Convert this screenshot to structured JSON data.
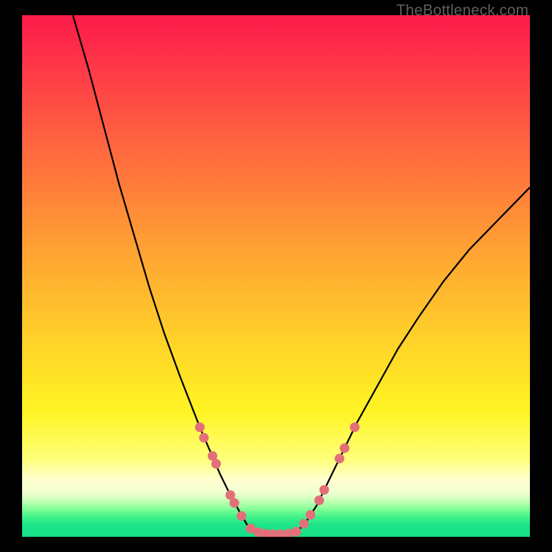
{
  "watermark": "TheBottleneck.com",
  "colors": {
    "frame": "#000000",
    "gradient_stops": [
      "#fd1a4a",
      "#fe3e47",
      "#ff6f3e",
      "#ffa233",
      "#ffd129",
      "#fff423",
      "#ffff7a",
      "#ffffcf",
      "#f0ffd1",
      "#c8ffb6",
      "#8bff9a",
      "#47f58b",
      "#20e588",
      "#15df87"
    ],
    "curve": "#000000",
    "dots": "#e37079"
  },
  "chart_data": {
    "type": "line",
    "title": "",
    "xlabel": "",
    "ylabel": "",
    "xlim": [
      0,
      100
    ],
    "ylim": [
      0,
      100
    ],
    "series": [
      {
        "name": "left-branch",
        "x": [
          10,
          13,
          16,
          19,
          22,
          25,
          28,
          31,
          33,
          35,
          37,
          39,
          41,
          43,
          44.5,
          46
        ],
        "y": [
          100,
          90,
          79,
          68,
          58,
          48,
          39,
          31,
          26,
          21,
          16.5,
          12,
          8,
          4.5,
          2,
          0.8
        ]
      },
      {
        "name": "valley-floor",
        "x": [
          46,
          48,
          50,
          52,
          54
        ],
        "y": [
          0.8,
          0.5,
          0.5,
          0.5,
          0.8
        ]
      },
      {
        "name": "right-branch",
        "x": [
          54,
          56,
          58,
          60,
          63,
          66,
          70,
          74,
          78,
          83,
          88,
          94,
          100
        ],
        "y": [
          0.8,
          3,
          6,
          10,
          16,
          22,
          29,
          36,
          42,
          49,
          55,
          61,
          67
        ]
      }
    ],
    "points": [
      {
        "name": "left-cluster-top-1",
        "x": 35.0,
        "y": 21.0
      },
      {
        "name": "left-cluster-top-2",
        "x": 35.8,
        "y": 19.0
      },
      {
        "name": "left-cluster-mid-1",
        "x": 37.5,
        "y": 15.5
      },
      {
        "name": "left-cluster-mid-2",
        "x": 38.2,
        "y": 14.0
      },
      {
        "name": "left-cluster-low-1",
        "x": 41.0,
        "y": 8.0
      },
      {
        "name": "left-cluster-low-2",
        "x": 41.8,
        "y": 6.5
      },
      {
        "name": "left-cluster-low-3",
        "x": 43.2,
        "y": 4.0
      },
      {
        "name": "valley-1",
        "x": 45.0,
        "y": 1.6
      },
      {
        "name": "valley-2",
        "x": 46.5,
        "y": 0.9
      },
      {
        "name": "valley-3",
        "x": 48.0,
        "y": 0.6
      },
      {
        "name": "valley-4",
        "x": 49.5,
        "y": 0.5
      },
      {
        "name": "valley-5",
        "x": 51.0,
        "y": 0.5
      },
      {
        "name": "valley-6",
        "x": 52.5,
        "y": 0.6
      },
      {
        "name": "valley-7",
        "x": 54.0,
        "y": 1.0
      },
      {
        "name": "right-cluster-low-1",
        "x": 55.5,
        "y": 2.5
      },
      {
        "name": "right-cluster-low-2",
        "x": 56.8,
        "y": 4.2
      },
      {
        "name": "right-cluster-mid-1",
        "x": 58.5,
        "y": 7.0
      },
      {
        "name": "right-cluster-mid-2",
        "x": 59.5,
        "y": 9.0
      },
      {
        "name": "right-cluster-top-1",
        "x": 62.5,
        "y": 15.0
      },
      {
        "name": "right-cluster-top-2",
        "x": 63.5,
        "y": 17.0
      },
      {
        "name": "right-cluster-top-3",
        "x": 65.5,
        "y": 21.0
      }
    ]
  }
}
